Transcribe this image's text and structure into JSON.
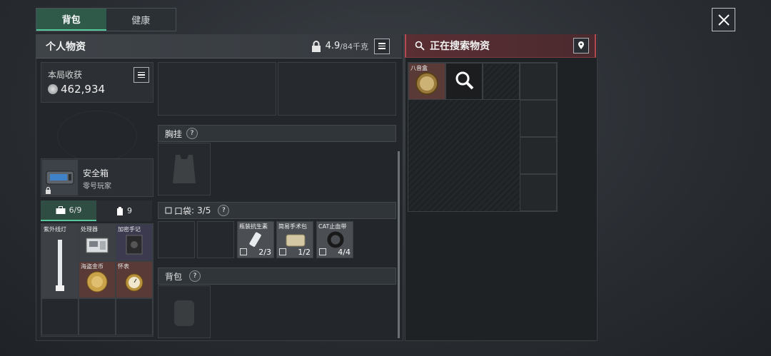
{
  "tabs": [
    {
      "label": "背包"
    },
    {
      "label": "健康"
    }
  ],
  "left_panel": {
    "title": "个人物资",
    "weight_value": "4.9",
    "weight_capacity": "/84千克"
  },
  "right_panel": {
    "title": "正在搜索物资"
  },
  "harvest": {
    "title": "本局收获",
    "value": "462,934"
  },
  "safe_box": {
    "title": "安全箱",
    "subtitle": "零号玩家"
  },
  "subtabs": [
    {
      "label": "6/9"
    },
    {
      "label": "9"
    }
  ],
  "safe_items": [
    {
      "label": "处理器"
    },
    {
      "label": "紫外线灯"
    },
    {
      "label": "加密手记"
    },
    {
      "label": "海盗金币"
    },
    {
      "label": "怀表"
    }
  ],
  "sections": {
    "chest_rig": {
      "title": "胸挂"
    },
    "pockets": {
      "title": "口袋",
      "count": "3/5"
    },
    "backpack": {
      "title": "背包"
    }
  },
  "pocket_items": [
    {
      "label": "瓶装抗生素",
      "count": "2/3"
    },
    {
      "label": "简易手术包",
      "count": "1/2"
    },
    {
      "label": "CAT止血带",
      "count": "4/4"
    }
  ],
  "search_item": {
    "label": "八音盒"
  }
}
